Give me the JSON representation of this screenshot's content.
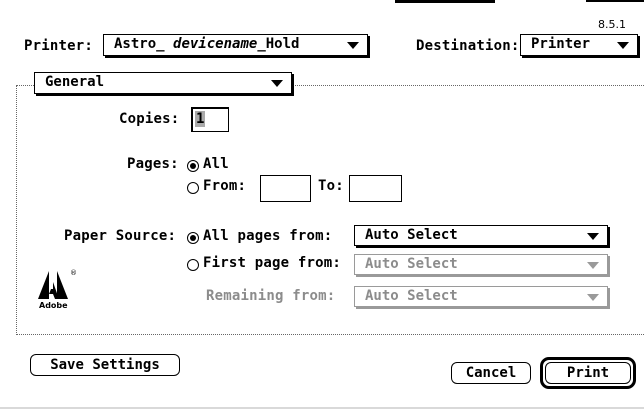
{
  "dialog": {
    "version": "8.5.1"
  },
  "printer": {
    "label": "Printer:",
    "value_prefix": "Astro_ ",
    "value_italic": "devicename",
    "value_suffix": "_Hold"
  },
  "destination": {
    "label": "Destination:",
    "value": "Printer"
  },
  "panel": {
    "value": "General"
  },
  "copies": {
    "label": "Copies:",
    "value": "1"
  },
  "pages": {
    "label": "Pages:",
    "all_label": "All",
    "from_label": "From:",
    "to_label": "To:",
    "from_value": "",
    "to_value": "",
    "selected": "All"
  },
  "paper_source": {
    "label": "Paper Source:",
    "all_pages_label": "All pages from:",
    "all_pages_value": "Auto Select",
    "first_page_label": "First page from:",
    "first_page_value": "Auto Select",
    "remaining_label": "Remaining from:",
    "remaining_value": "Auto Select",
    "selected": "All pages from:"
  },
  "logo": {
    "text": "Adobe",
    "registered": "®"
  },
  "buttons": {
    "save": "Save Settings",
    "cancel": "Cancel",
    "print": "Print"
  },
  "colors": {
    "disabled": "#8c8c8c",
    "background": "#ffffff",
    "text": "#000000"
  }
}
